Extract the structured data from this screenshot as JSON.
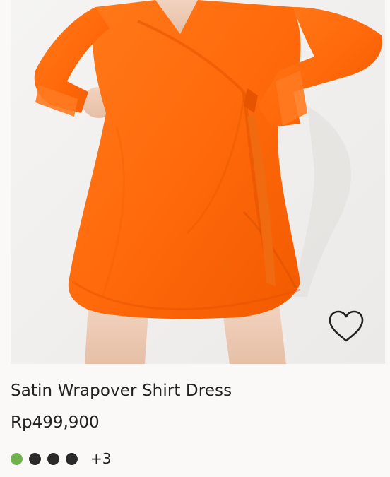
{
  "product": {
    "name": "Satin Wrapover Shirt Dress",
    "price": "Rp499,900",
    "colors": [
      {
        "name": "green",
        "hex": "#6fb24e"
      },
      {
        "name": "black-1",
        "hex": "#2b2b2b"
      },
      {
        "name": "black-2",
        "hex": "#2b2b2b"
      },
      {
        "name": "black-3",
        "hex": "#2b2b2b"
      }
    ],
    "more_colors_label": "+3"
  },
  "icons": {
    "favorite": "heart-outline-icon"
  },
  "theme": {
    "dress_color": "#ff6a0c",
    "background": "#faf9f8"
  }
}
